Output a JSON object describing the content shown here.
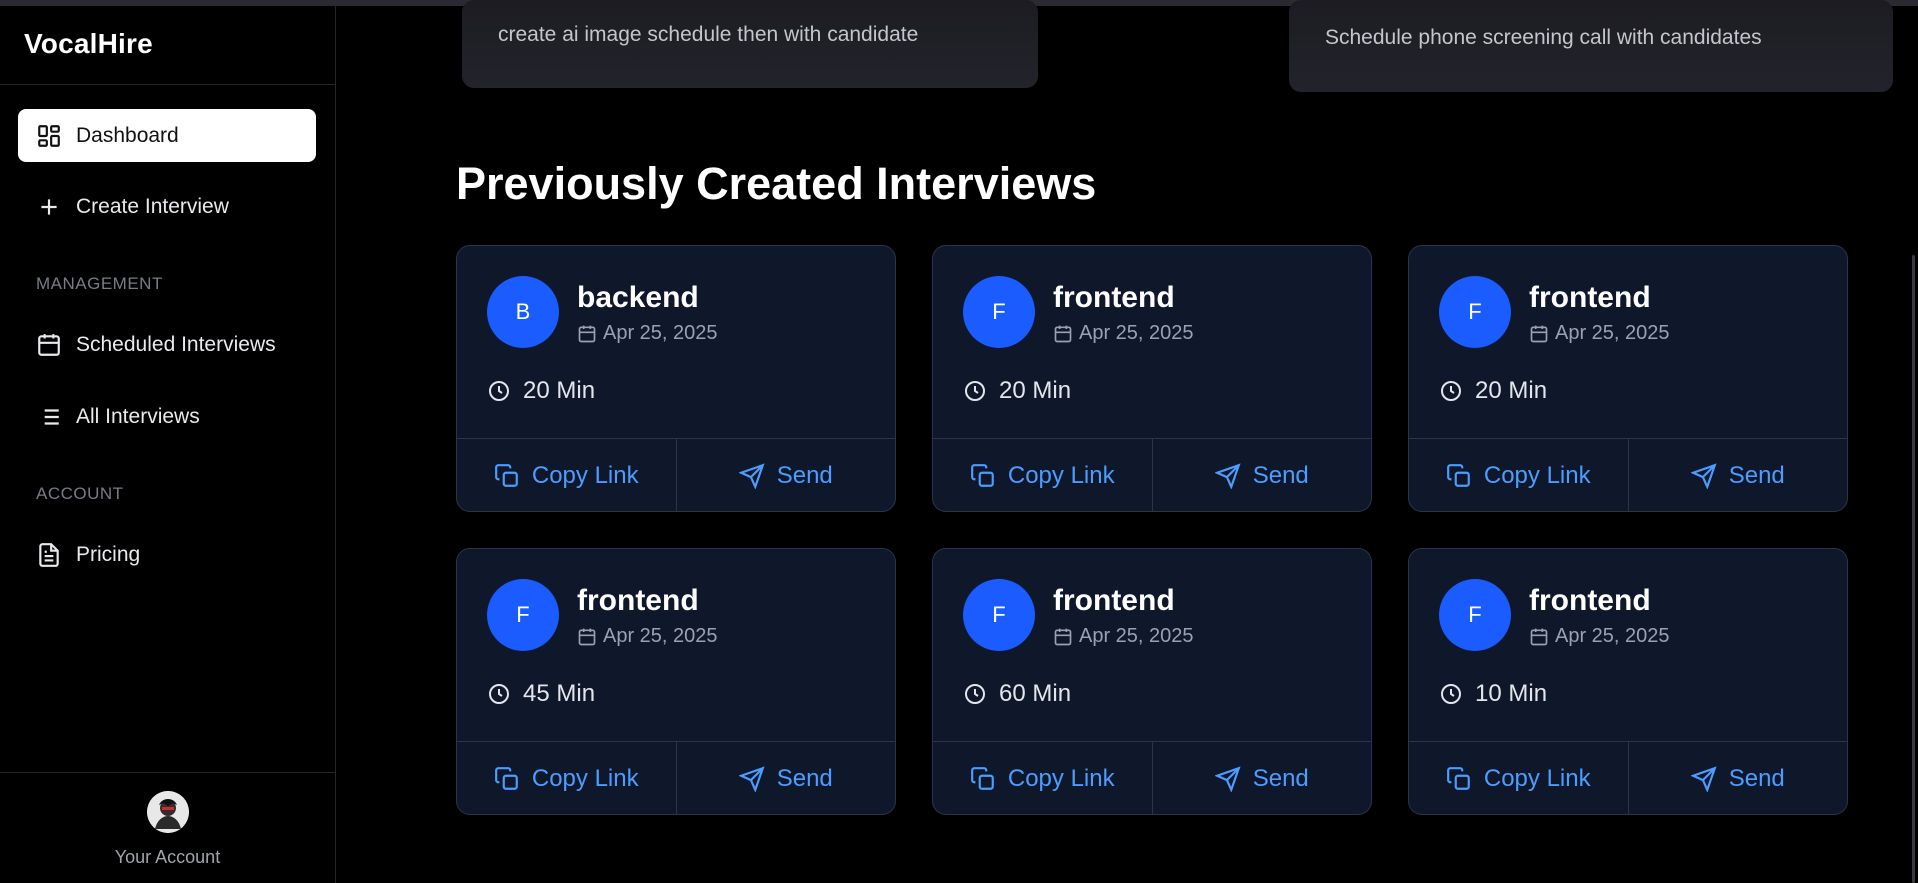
{
  "app": {
    "brand": "VocalHire"
  },
  "sidebar": {
    "nav": [
      {
        "label": "Dashboard",
        "icon": "dashboard-icon",
        "active": true
      },
      {
        "label": "Create Interview",
        "icon": "plus-icon"
      }
    ],
    "management_label": "MANAGEMENT",
    "management": [
      {
        "label": "Scheduled Interviews",
        "icon": "calendar-icon"
      },
      {
        "label": "All Interviews",
        "icon": "list-icon"
      }
    ],
    "account_label": "ACCOUNT",
    "account": [
      {
        "label": "Pricing",
        "icon": "document-icon"
      }
    ],
    "footer": {
      "label": "Your Account"
    }
  },
  "top_cards": [
    {
      "text": "create ai image schedule then with candidate"
    },
    {
      "text": "Schedule phone screening call with candidates"
    }
  ],
  "main": {
    "title": "Previously Created Interviews",
    "interviews": [
      {
        "initial": "B",
        "role": "backend",
        "date": "Apr 25, 2025",
        "duration": "20 Min",
        "copy_label": "Copy Link",
        "send_label": "Send"
      },
      {
        "initial": "F",
        "role": "frontend",
        "date": "Apr 25, 2025",
        "duration": "20 Min",
        "copy_label": "Copy Link",
        "send_label": "Send"
      },
      {
        "initial": "F",
        "role": "frontend",
        "date": "Apr 25, 2025",
        "duration": "20 Min",
        "copy_label": "Copy Link",
        "send_label": "Send"
      },
      {
        "initial": "F",
        "role": "frontend",
        "date": "Apr 25, 2025",
        "duration": "45 Min",
        "copy_label": "Copy Link",
        "send_label": "Send"
      },
      {
        "initial": "F",
        "role": "frontend",
        "date": "Apr 25, 2025",
        "duration": "60 Min",
        "copy_label": "Copy Link",
        "send_label": "Send"
      },
      {
        "initial": "F",
        "role": "frontend",
        "date": "Apr 25, 2025",
        "duration": "10 Min",
        "copy_label": "Copy Link",
        "send_label": "Send"
      }
    ]
  },
  "colors": {
    "accent": "#4d9cff",
    "avatar_blue": "#1a5cff",
    "card_bg": "#0f172a"
  }
}
